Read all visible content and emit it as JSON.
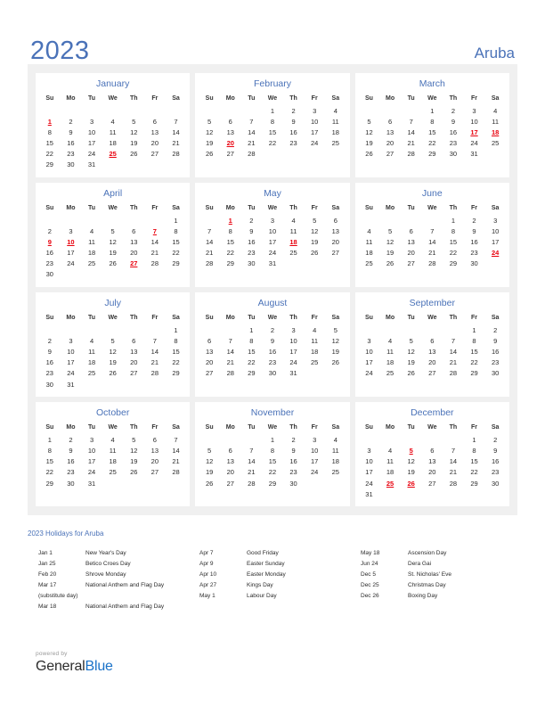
{
  "header": {
    "year": "2023",
    "country": "Aruba",
    "accent_color": "#4a72b8",
    "holiday_color": "#e8000d"
  },
  "weekdays": [
    "Su",
    "Mo",
    "Tu",
    "We",
    "Th",
    "Fr",
    "Sa"
  ],
  "months": [
    {
      "name": "January",
      "weeks": [
        [
          "",
          "",
          "",
          "",
          "",
          "",
          ""
        ],
        [
          "1",
          "2",
          "3",
          "4",
          "5",
          "6",
          "7"
        ],
        [
          "8",
          "9",
          "10",
          "11",
          "12",
          "13",
          "14"
        ],
        [
          "15",
          "16",
          "17",
          "18",
          "19",
          "20",
          "21"
        ],
        [
          "22",
          "23",
          "24",
          "25",
          "26",
          "27",
          "28"
        ],
        [
          "29",
          "30",
          "31",
          "",
          "",
          "",
          ""
        ]
      ],
      "holidays": [
        "1",
        "25"
      ]
    },
    {
      "name": "February",
      "weeks": [
        [
          "",
          "",
          "",
          "1",
          "2",
          "3",
          "4"
        ],
        [
          "5",
          "6",
          "7",
          "8",
          "9",
          "10",
          "11"
        ],
        [
          "12",
          "13",
          "14",
          "15",
          "16",
          "17",
          "18"
        ],
        [
          "19",
          "20",
          "21",
          "22",
          "23",
          "24",
          "25"
        ],
        [
          "26",
          "27",
          "28",
          "",
          "",
          "",
          ""
        ],
        [
          "",
          "",
          "",
          "",
          "",
          "",
          ""
        ]
      ],
      "holidays": [
        "20"
      ]
    },
    {
      "name": "March",
      "weeks": [
        [
          "",
          "",
          "",
          "1",
          "2",
          "3",
          "4"
        ],
        [
          "5",
          "6",
          "7",
          "8",
          "9",
          "10",
          "11"
        ],
        [
          "12",
          "13",
          "14",
          "15",
          "16",
          "17",
          "18"
        ],
        [
          "19",
          "20",
          "21",
          "22",
          "23",
          "24",
          "25"
        ],
        [
          "26",
          "27",
          "28",
          "29",
          "30",
          "31",
          ""
        ],
        [
          "",
          "",
          "",
          "",
          "",
          "",
          ""
        ]
      ],
      "holidays": [
        "17",
        "18"
      ]
    },
    {
      "name": "April",
      "weeks": [
        [
          "",
          "",
          "",
          "",
          "",
          "",
          "1"
        ],
        [
          "2",
          "3",
          "4",
          "5",
          "6",
          "7",
          "8"
        ],
        [
          "9",
          "10",
          "11",
          "12",
          "13",
          "14",
          "15"
        ],
        [
          "16",
          "17",
          "18",
          "19",
          "20",
          "21",
          "22"
        ],
        [
          "23",
          "24",
          "25",
          "26",
          "27",
          "28",
          "29"
        ],
        [
          "30",
          "",
          "",
          "",
          "",
          "",
          ""
        ]
      ],
      "holidays": [
        "7",
        "9",
        "10",
        "27"
      ]
    },
    {
      "name": "May",
      "weeks": [
        [
          "",
          "1",
          "2",
          "3",
          "4",
          "5",
          "6"
        ],
        [
          "7",
          "8",
          "9",
          "10",
          "11",
          "12",
          "13"
        ],
        [
          "14",
          "15",
          "16",
          "17",
          "18",
          "19",
          "20"
        ],
        [
          "21",
          "22",
          "23",
          "24",
          "25",
          "26",
          "27"
        ],
        [
          "28",
          "29",
          "30",
          "31",
          "",
          "",
          ""
        ],
        [
          "",
          "",
          "",
          "",
          "",
          "",
          ""
        ]
      ],
      "holidays": [
        "1",
        "18"
      ]
    },
    {
      "name": "June",
      "weeks": [
        [
          "",
          "",
          "",
          "",
          "1",
          "2",
          "3"
        ],
        [
          "4",
          "5",
          "6",
          "7",
          "8",
          "9",
          "10"
        ],
        [
          "11",
          "12",
          "13",
          "14",
          "15",
          "16",
          "17"
        ],
        [
          "18",
          "19",
          "20",
          "21",
          "22",
          "23",
          "24"
        ],
        [
          "25",
          "26",
          "27",
          "28",
          "29",
          "30",
          ""
        ],
        [
          "",
          "",
          "",
          "",
          "",
          "",
          ""
        ]
      ],
      "holidays": [
        "24"
      ]
    },
    {
      "name": "July",
      "weeks": [
        [
          "",
          "",
          "",
          "",
          "",
          "",
          "1"
        ],
        [
          "2",
          "3",
          "4",
          "5",
          "6",
          "7",
          "8"
        ],
        [
          "9",
          "10",
          "11",
          "12",
          "13",
          "14",
          "15"
        ],
        [
          "16",
          "17",
          "18",
          "19",
          "20",
          "21",
          "22"
        ],
        [
          "23",
          "24",
          "25",
          "26",
          "27",
          "28",
          "29"
        ],
        [
          "30",
          "31",
          "",
          "",
          "",
          "",
          ""
        ]
      ],
      "holidays": []
    },
    {
      "name": "August",
      "weeks": [
        [
          "",
          "",
          "1",
          "2",
          "3",
          "4",
          "5"
        ],
        [
          "6",
          "7",
          "8",
          "9",
          "10",
          "11",
          "12"
        ],
        [
          "13",
          "14",
          "15",
          "16",
          "17",
          "18",
          "19"
        ],
        [
          "20",
          "21",
          "22",
          "23",
          "24",
          "25",
          "26"
        ],
        [
          "27",
          "28",
          "29",
          "30",
          "31",
          "",
          ""
        ],
        [
          "",
          "",
          "",
          "",
          "",
          "",
          ""
        ]
      ],
      "holidays": []
    },
    {
      "name": "September",
      "weeks": [
        [
          "",
          "",
          "",
          "",
          "",
          "1",
          "2"
        ],
        [
          "3",
          "4",
          "5",
          "6",
          "7",
          "8",
          "9"
        ],
        [
          "10",
          "11",
          "12",
          "13",
          "14",
          "15",
          "16"
        ],
        [
          "17",
          "18",
          "19",
          "20",
          "21",
          "22",
          "23"
        ],
        [
          "24",
          "25",
          "26",
          "27",
          "28",
          "29",
          "30"
        ],
        [
          "",
          "",
          "",
          "",
          "",
          "",
          ""
        ]
      ],
      "holidays": []
    },
    {
      "name": "October",
      "weeks": [
        [
          "1",
          "2",
          "3",
          "4",
          "5",
          "6",
          "7"
        ],
        [
          "8",
          "9",
          "10",
          "11",
          "12",
          "13",
          "14"
        ],
        [
          "15",
          "16",
          "17",
          "18",
          "19",
          "20",
          "21"
        ],
        [
          "22",
          "23",
          "24",
          "25",
          "26",
          "27",
          "28"
        ],
        [
          "29",
          "30",
          "31",
          "",
          "",
          "",
          ""
        ],
        [
          "",
          "",
          "",
          "",
          "",
          "",
          ""
        ]
      ],
      "holidays": []
    },
    {
      "name": "November",
      "weeks": [
        [
          "",
          "",
          "",
          "1",
          "2",
          "3",
          "4"
        ],
        [
          "5",
          "6",
          "7",
          "8",
          "9",
          "10",
          "11"
        ],
        [
          "12",
          "13",
          "14",
          "15",
          "16",
          "17",
          "18"
        ],
        [
          "19",
          "20",
          "21",
          "22",
          "23",
          "24",
          "25"
        ],
        [
          "26",
          "27",
          "28",
          "29",
          "30",
          "",
          ""
        ],
        [
          "",
          "",
          "",
          "",
          "",
          "",
          ""
        ]
      ],
      "holidays": []
    },
    {
      "name": "December",
      "weeks": [
        [
          "",
          "",
          "",
          "",
          "",
          "1",
          "2"
        ],
        [
          "3",
          "4",
          "5",
          "6",
          "7",
          "8",
          "9"
        ],
        [
          "10",
          "11",
          "12",
          "13",
          "14",
          "15",
          "16"
        ],
        [
          "17",
          "18",
          "19",
          "20",
          "21",
          "22",
          "23"
        ],
        [
          "24",
          "25",
          "26",
          "27",
          "28",
          "29",
          "30"
        ],
        [
          "31",
          "",
          "",
          "",
          "",
          "",
          ""
        ]
      ],
      "holidays": [
        "5",
        "25",
        "26"
      ]
    }
  ],
  "holidays_section": {
    "title": "2023 Holidays for Aruba",
    "columns": [
      [
        {
          "date": "Jan 1",
          "name": "New Year's Day"
        },
        {
          "date": "Jan 25",
          "name": "Betico Croes Day"
        },
        {
          "date": "Feb 20",
          "name": "Shrove Monday"
        },
        {
          "date": "Mar 17",
          "name": "National Anthem and Flag Day"
        },
        {
          "date": "(substitute day)",
          "name": "",
          "continuation": true
        },
        {
          "date": "Mar 18",
          "name": "National Anthem and Flag Day"
        }
      ],
      [
        {
          "date": "Apr 7",
          "name": "Good Friday"
        },
        {
          "date": "Apr 9",
          "name": "Easter Sunday"
        },
        {
          "date": "Apr 10",
          "name": "Easter Monday"
        },
        {
          "date": "Apr 27",
          "name": "Kings Day"
        },
        {
          "date": "May 1",
          "name": "Labour Day"
        }
      ],
      [
        {
          "date": "May 18",
          "name": "Ascension Day"
        },
        {
          "date": "Jun 24",
          "name": "Dera Gai"
        },
        {
          "date": "Dec 5",
          "name": "St. Nicholas' Eve"
        },
        {
          "date": "Dec 25",
          "name": "Christmas Day"
        },
        {
          "date": "Dec 26",
          "name": "Boxing Day"
        }
      ]
    ]
  },
  "footer": {
    "powered_by": "powered by",
    "brand_first": "General",
    "brand_second": "Blue"
  }
}
